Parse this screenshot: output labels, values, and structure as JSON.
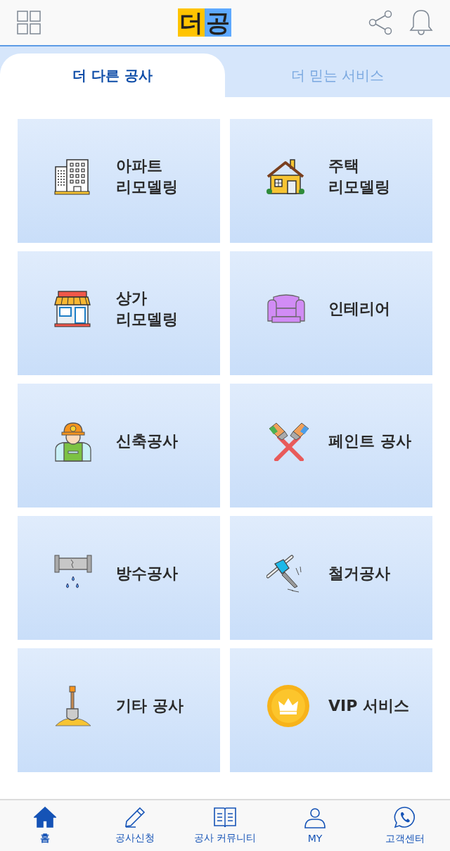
{
  "header": {
    "logo": [
      {
        "text": "더",
        "color": "#ffc400"
      },
      {
        "text": "공",
        "color": "#5ea9ff"
      }
    ]
  },
  "tabs": [
    {
      "label": "더 다른 공사",
      "selected": true
    },
    {
      "label": "더 믿는 서비스",
      "selected": false
    }
  ],
  "tiles": [
    {
      "kind": "apartment",
      "lines": [
        "아파트",
        "리모델링"
      ]
    },
    {
      "kind": "house",
      "lines": [
        "주택",
        "리모델링"
      ]
    },
    {
      "kind": "shop",
      "lines": [
        "상가",
        "리모델링"
      ]
    },
    {
      "kind": "sofa",
      "lines": [
        "인테리어"
      ]
    },
    {
      "kind": "worker",
      "lines": [
        "신축공사"
      ]
    },
    {
      "kind": "paint",
      "lines": [
        "페인트 공사"
      ]
    },
    {
      "kind": "pipe",
      "lines": [
        "방수공사"
      ]
    },
    {
      "kind": "drill",
      "lines": [
        "철거공사"
      ]
    },
    {
      "kind": "shovel",
      "lines": [
        "기타 공사"
      ]
    },
    {
      "kind": "vip",
      "lines": [
        "VIP 서비스"
      ]
    }
  ],
  "bottom_nav": [
    {
      "kind": "home",
      "label": "홈",
      "selected": true
    },
    {
      "kind": "pencil",
      "label": "공사신청",
      "selected": false
    },
    {
      "kind": "book",
      "label": "공사 커뮤니티",
      "selected": false
    },
    {
      "kind": "person",
      "label": "MY",
      "selected": false
    },
    {
      "kind": "chat",
      "label": "고객센터",
      "selected": false
    }
  ]
}
